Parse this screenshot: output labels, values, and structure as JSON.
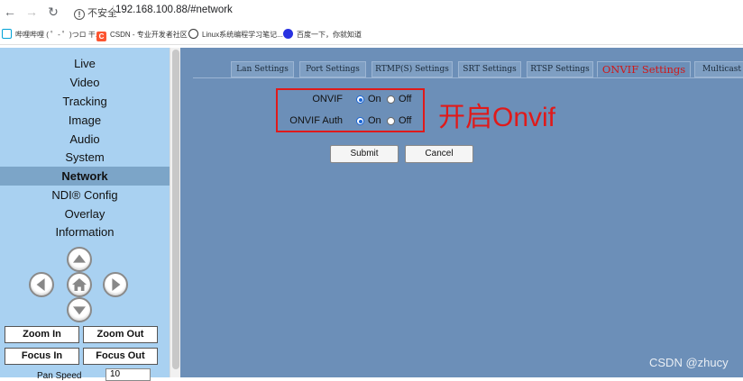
{
  "browser": {
    "security_label": "不安全",
    "url": "192.168.100.88/#network",
    "bookmarks": [
      {
        "label": "哔哩哔哩 ( ゜- ゜)つロ 干...",
        "color": "#00a1d6"
      },
      {
        "label": "CSDN - 专业开发者社区",
        "color": "#fc5531"
      },
      {
        "label": "Linux系统编程学习笔记...",
        "color": "#333333"
      },
      {
        "label": "百度一下，你就知道",
        "color": "#2932e1"
      }
    ]
  },
  "menu": {
    "items": [
      "Live",
      "Video",
      "Tracking",
      "Image",
      "Audio",
      "System",
      "Network",
      "NDI® Config",
      "Overlay",
      "Information"
    ],
    "active": "Network",
    "zoom_in": "Zoom In",
    "zoom_out": "Zoom Out",
    "focus_in": "Focus In",
    "focus_out": "Focus Out",
    "pan_speed_label": "Pan Speed",
    "pan_speed_value": "10"
  },
  "tabs": [
    "Lan Settings",
    "Port Settings",
    "RTMP(S) Settings",
    "SRT Settings",
    "RTSP Settings",
    "ONVIF Settings",
    "Multicast"
  ],
  "active_tab": "ONVIF Settings",
  "onvif": {
    "rows": [
      {
        "label": "ONVIF",
        "on_label": "On",
        "off_label": "Off",
        "selected": "On"
      },
      {
        "label": "ONVIF Auth",
        "on_label": "On",
        "off_label": "Off",
        "selected": "On"
      }
    ],
    "submit": "Submit",
    "cancel": "Cancel"
  },
  "annotation": "开启Onvif",
  "watermark": "CSDN @zhucy",
  "colors": {
    "menu_bg": "#a9d1f1",
    "menu_active": "#7ca5c8",
    "content_bg": "#6c8fb8",
    "active_tab_text": "#d01818",
    "annotation": "#e01a1a"
  }
}
